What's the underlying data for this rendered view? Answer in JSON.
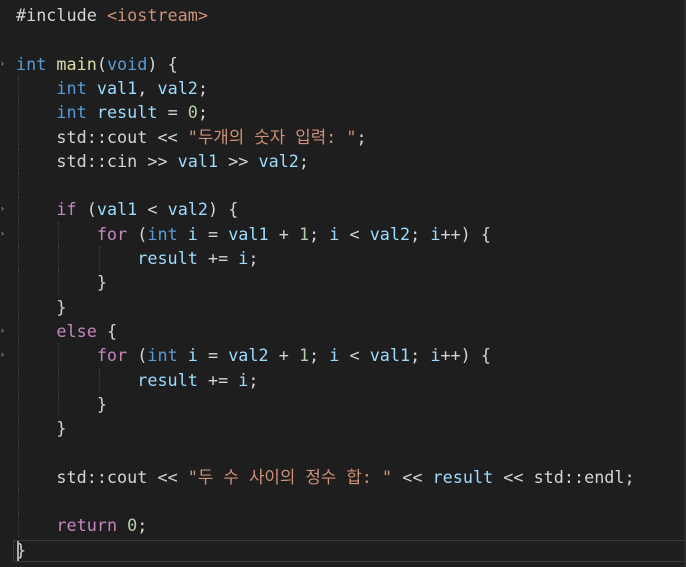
{
  "editor": {
    "language": "cpp",
    "theme_background": "#1e1e1e",
    "lines": [
      {
        "tokens": [
          {
            "t": "#include ",
            "c": "ppkw"
          },
          {
            "t": "<iostream>",
            "c": "ppt"
          }
        ]
      },
      {
        "tokens": []
      },
      {
        "fold": true,
        "tokens": [
          {
            "t": "int",
            "c": "kw"
          },
          {
            "t": " ",
            "c": "plain"
          },
          {
            "t": "main",
            "c": "fn"
          },
          {
            "t": "(",
            "c": "plain"
          },
          {
            "t": "void",
            "c": "kw"
          },
          {
            "t": ") {",
            "c": "plain"
          }
        ]
      },
      {
        "tokens": [
          {
            "t": "    ",
            "c": "plain"
          },
          {
            "t": "int",
            "c": "kw"
          },
          {
            "t": " ",
            "c": "plain"
          },
          {
            "t": "val1",
            "c": "var"
          },
          {
            "t": ", ",
            "c": "plain"
          },
          {
            "t": "val2",
            "c": "var"
          },
          {
            "t": ";",
            "c": "plain"
          }
        ]
      },
      {
        "tokens": [
          {
            "t": "    ",
            "c": "plain"
          },
          {
            "t": "int",
            "c": "kw"
          },
          {
            "t": " ",
            "c": "plain"
          },
          {
            "t": "result",
            "c": "var"
          },
          {
            "t": " = ",
            "c": "plain"
          },
          {
            "t": "0",
            "c": "num"
          },
          {
            "t": ";",
            "c": "plain"
          }
        ]
      },
      {
        "tokens": [
          {
            "t": "    std::cout << ",
            "c": "plain"
          },
          {
            "t": "\"두개의 숫자 입력: \"",
            "c": "str"
          },
          {
            "t": ";",
            "c": "plain"
          }
        ]
      },
      {
        "tokens": [
          {
            "t": "    std::cin >> ",
            "c": "plain"
          },
          {
            "t": "val1",
            "c": "var"
          },
          {
            "t": " >> ",
            "c": "plain"
          },
          {
            "t": "val2",
            "c": "var"
          },
          {
            "t": ";",
            "c": "plain"
          }
        ]
      },
      {
        "tokens": []
      },
      {
        "fold": true,
        "tokens": [
          {
            "t": "    ",
            "c": "plain"
          },
          {
            "t": "if",
            "c": "ctl"
          },
          {
            "t": " (",
            "c": "plain"
          },
          {
            "t": "val1",
            "c": "var"
          },
          {
            "t": " < ",
            "c": "plain"
          },
          {
            "t": "val2",
            "c": "var"
          },
          {
            "t": ") {",
            "c": "plain"
          }
        ]
      },
      {
        "fold": true,
        "tokens": [
          {
            "t": "        ",
            "c": "plain"
          },
          {
            "t": "for",
            "c": "ctl"
          },
          {
            "t": " (",
            "c": "plain"
          },
          {
            "t": "int",
            "c": "kw"
          },
          {
            "t": " ",
            "c": "plain"
          },
          {
            "t": "i",
            "c": "var"
          },
          {
            "t": " = ",
            "c": "plain"
          },
          {
            "t": "val1",
            "c": "var"
          },
          {
            "t": " + ",
            "c": "plain"
          },
          {
            "t": "1",
            "c": "num"
          },
          {
            "t": "; ",
            "c": "plain"
          },
          {
            "t": "i",
            "c": "var"
          },
          {
            "t": " < ",
            "c": "plain"
          },
          {
            "t": "val2",
            "c": "var"
          },
          {
            "t": "; ",
            "c": "plain"
          },
          {
            "t": "i",
            "c": "var"
          },
          {
            "t": "++) {",
            "c": "plain"
          }
        ]
      },
      {
        "tokens": [
          {
            "t": "            ",
            "c": "plain"
          },
          {
            "t": "result",
            "c": "var"
          },
          {
            "t": " += ",
            "c": "plain"
          },
          {
            "t": "i",
            "c": "var"
          },
          {
            "t": ";",
            "c": "plain"
          }
        ]
      },
      {
        "tokens": [
          {
            "t": "        }",
            "c": "plain"
          }
        ]
      },
      {
        "tokens": [
          {
            "t": "    }",
            "c": "plain"
          }
        ]
      },
      {
        "fold": true,
        "tokens": [
          {
            "t": "    ",
            "c": "plain"
          },
          {
            "t": "else",
            "c": "ctl"
          },
          {
            "t": " {",
            "c": "plain"
          }
        ]
      },
      {
        "fold": true,
        "tokens": [
          {
            "t": "        ",
            "c": "plain"
          },
          {
            "t": "for",
            "c": "ctl"
          },
          {
            "t": " (",
            "c": "plain"
          },
          {
            "t": "int",
            "c": "kw"
          },
          {
            "t": " ",
            "c": "plain"
          },
          {
            "t": "i",
            "c": "var"
          },
          {
            "t": " = ",
            "c": "plain"
          },
          {
            "t": "val2",
            "c": "var"
          },
          {
            "t": " + ",
            "c": "plain"
          },
          {
            "t": "1",
            "c": "num"
          },
          {
            "t": "; ",
            "c": "plain"
          },
          {
            "t": "i",
            "c": "var"
          },
          {
            "t": " < ",
            "c": "plain"
          },
          {
            "t": "val1",
            "c": "var"
          },
          {
            "t": "; ",
            "c": "plain"
          },
          {
            "t": "i",
            "c": "var"
          },
          {
            "t": "++) {",
            "c": "plain"
          }
        ]
      },
      {
        "tokens": [
          {
            "t": "            ",
            "c": "plain"
          },
          {
            "t": "result",
            "c": "var"
          },
          {
            "t": " += ",
            "c": "plain"
          },
          {
            "t": "i",
            "c": "var"
          },
          {
            "t": ";",
            "c": "plain"
          }
        ]
      },
      {
        "tokens": [
          {
            "t": "        }",
            "c": "plain"
          }
        ]
      },
      {
        "tokens": [
          {
            "t": "    }",
            "c": "plain"
          }
        ]
      },
      {
        "tokens": []
      },
      {
        "tokens": [
          {
            "t": "    std::cout << ",
            "c": "plain"
          },
          {
            "t": "\"두 수 사이의 정수 합: \"",
            "c": "str"
          },
          {
            "t": " << ",
            "c": "plain"
          },
          {
            "t": "result",
            "c": "var"
          },
          {
            "t": " << std::endl;",
            "c": "plain"
          }
        ]
      },
      {
        "tokens": []
      },
      {
        "tokens": [
          {
            "t": "    ",
            "c": "plain"
          },
          {
            "t": "return",
            "c": "ctl"
          },
          {
            "t": " ",
            "c": "plain"
          },
          {
            "t": "0",
            "c": "num"
          },
          {
            "t": ";",
            "c": "plain"
          }
        ]
      },
      {
        "tokens": [
          {
            "t": "}",
            "c": "plain"
          }
        ]
      }
    ]
  }
}
